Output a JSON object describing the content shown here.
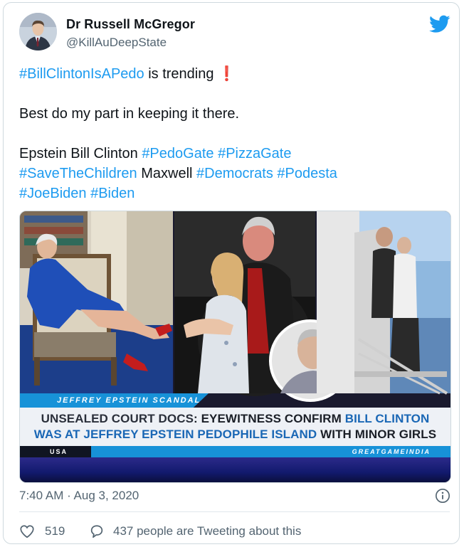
{
  "author": {
    "display_name": "Dr Russell McGregor",
    "handle": "@KillAuDeepState",
    "avatar_icon": "profile-photo"
  },
  "tweet": {
    "line1_tag": "#BillClintonIsAPedo",
    "line1_rest": " is trending ",
    "line1_emoji": "❗",
    "line2": "Best do my part in keeping it there.",
    "line3_prefix": "Epstein Bill Clinton ",
    "tags_a": [
      "#PedoGate",
      "#PizzaGate"
    ],
    "line4_tag": "#SaveTheChildren",
    "line4_mid": " Maxwell ",
    "tags_b": [
      "#Democrats",
      "#Podesta"
    ],
    "tags_c": [
      "#JoeBiden",
      "#Biden"
    ]
  },
  "media": {
    "banner_tag": "JEFFREY EPSTEIN SCANDAL",
    "headline_line1_a": "UNSEALED COURT DOCS",
    "headline_line1_b": ": EYEWITNESS CONFIRM ",
    "headline_line1_c": "BILL CLINTON",
    "headline_line2_a": "WAS AT JEFFREY EPSTEIN PEDOPHILE ISLAND",
    "headline_line2_b": " WITH MINOR GIRLS",
    "footer_left": "USA",
    "footer_source": "GREATGAMEINDIA"
  },
  "meta": {
    "timestamp": "7:40 AM · Aug 3, 2020"
  },
  "actions": {
    "like_count": "519",
    "talking_text": "437 people are Tweeting about this"
  },
  "colors": {
    "link": "#1d9bf0",
    "secondary_text": "#536471",
    "banner_blue": "#1792d8"
  },
  "icons": {
    "brand": "twitter-bird-icon",
    "info": "info-icon",
    "like": "heart-icon",
    "reply": "speech-bubble-icon"
  }
}
